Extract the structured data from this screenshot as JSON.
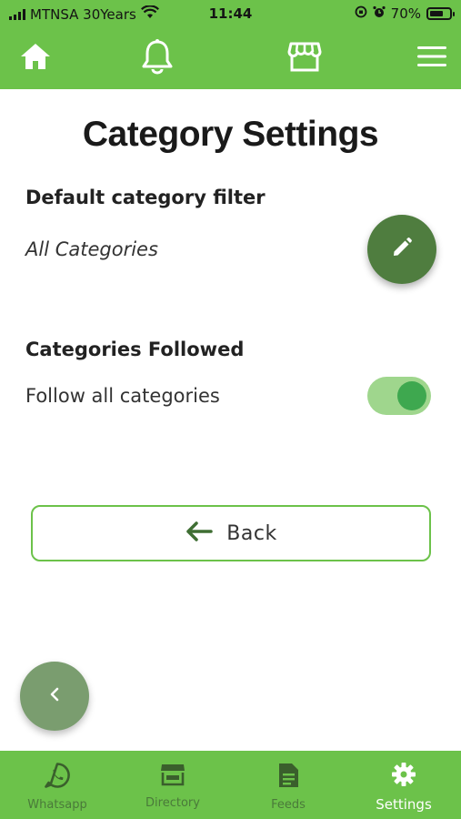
{
  "status_bar": {
    "carrier": "MTNSA 30Years",
    "time": "11:44",
    "battery": "70%",
    "battery_level": 0.7
  },
  "top_nav": {
    "items": [
      {
        "icon": "home-icon"
      },
      {
        "icon": "bell-icon"
      },
      {
        "icon": "store-icon"
      },
      {
        "icon": "menu-icon"
      }
    ]
  },
  "page": {
    "title": "Category Settings",
    "default_filter": {
      "heading": "Default category filter",
      "value": "All Categories"
    },
    "followed": {
      "heading": "Categories Followed",
      "label": "Follow all categories",
      "enabled": true
    },
    "back_label": "Back"
  },
  "bottom_tabs": [
    {
      "label": "Whatsapp",
      "icon": "whatsapp-icon",
      "active": false
    },
    {
      "label": "Directory",
      "icon": "directory-icon",
      "active": false
    },
    {
      "label": "Feeds",
      "icon": "feeds-icon",
      "active": false
    },
    {
      "label": "Settings",
      "icon": "gear-icon",
      "active": true
    }
  ],
  "colors": {
    "brand": "#6cc24a",
    "fab": "#4f7d3f",
    "toggle_on": "#3ea84f"
  }
}
